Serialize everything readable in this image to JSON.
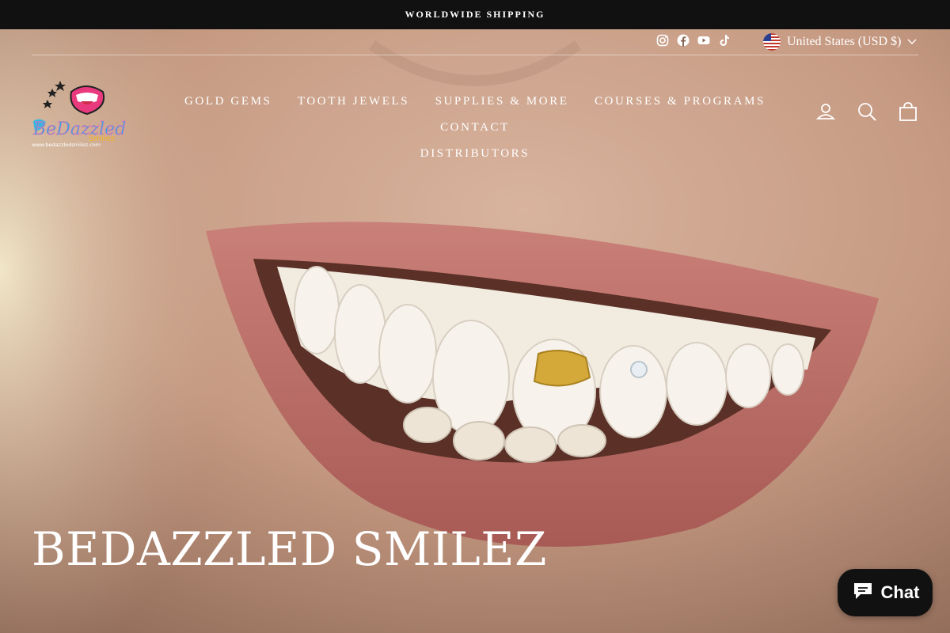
{
  "announcement": "WORLDWIDE SHIPPING",
  "social_icons": [
    "instagram-icon",
    "facebook-icon",
    "youtube-icon",
    "tiktok-icon"
  ],
  "currency": {
    "label": "United States (USD $)",
    "flag": "us-flag-icon"
  },
  "logo": {
    "alt": "BeDazzled Smilez",
    "tagline": "www.bedazzledsmilez.com"
  },
  "nav": {
    "items": [
      "GOLD GEMS",
      "TOOTH JEWELS",
      "SUPPLIES & MORE",
      "COURSES & PROGRAMS",
      "CONTACT",
      "DISTRIBUTORS"
    ]
  },
  "header_icons": [
    "account-icon",
    "search-icon",
    "cart-icon"
  ],
  "hero": {
    "title": "BEDAZZLED SMILEZ"
  },
  "chat": {
    "label": "Chat"
  },
  "colors": {
    "topbar": "#111111",
    "chat": "#111111"
  }
}
